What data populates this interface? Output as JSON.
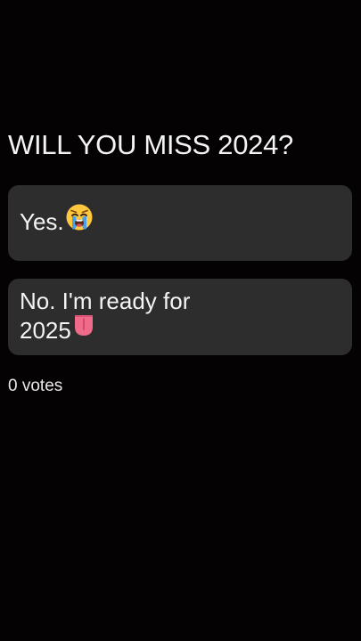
{
  "poll": {
    "question": "WILL YOU MISS 2024?",
    "options": [
      {
        "label": "Yes.",
        "emoji": "loudly-crying-face"
      },
      {
        "label": "No. I'm ready for 2025",
        "emoji": "tongue"
      }
    ],
    "votes_label": "0 votes"
  },
  "colors": {
    "background": "#040203",
    "option_background": "#2d2d2d",
    "text": "#f4f4f4"
  }
}
